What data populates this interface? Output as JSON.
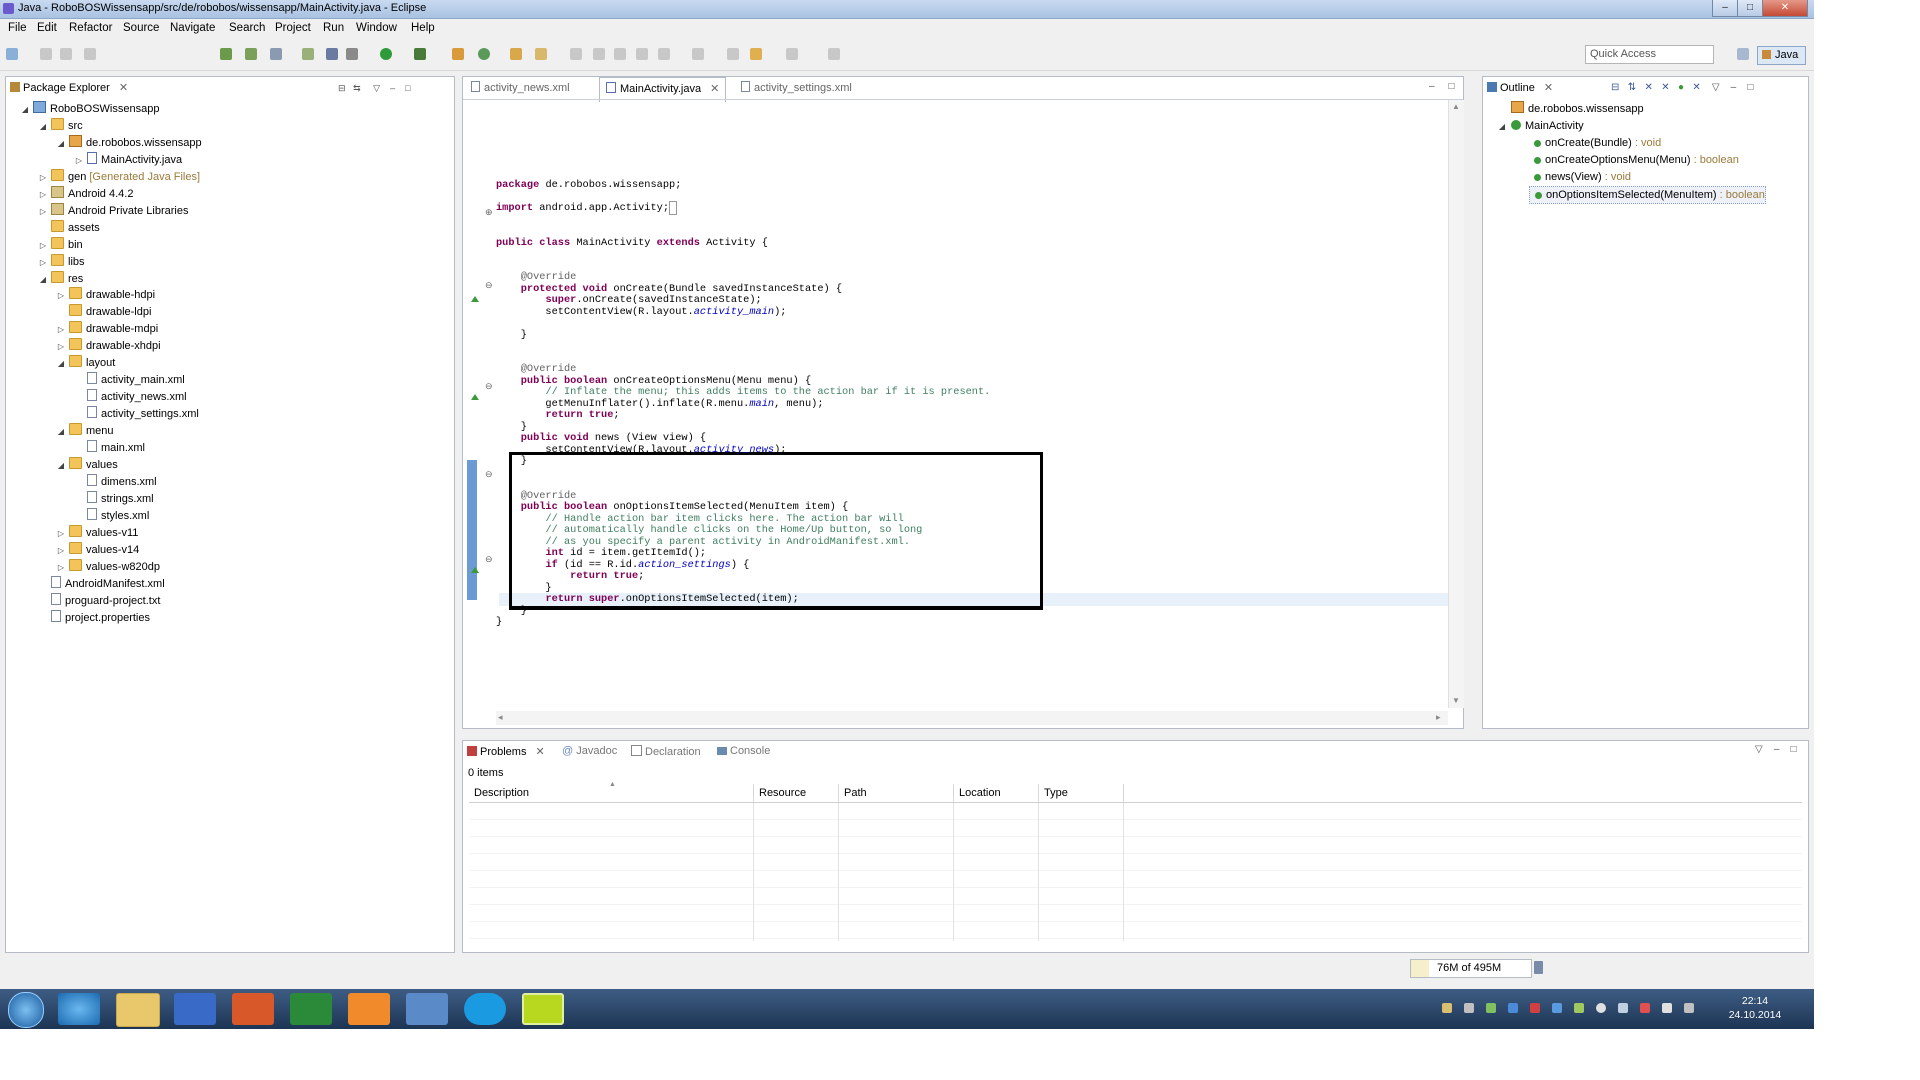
{
  "window": {
    "title": "Java - RoboBOSWissensapp/src/de/robobos/wissensapp/MainActivity.java - Eclipse",
    "controls": [
      "–",
      "□",
      "✕"
    ]
  },
  "menu": [
    "File",
    "Edit",
    "Refactor",
    "Source",
    "Navigate",
    "Search",
    "Project",
    "Run",
    "Window",
    "Help"
  ],
  "toolbar": {
    "quick_access_placeholder": "Quick Access",
    "perspective": "Java"
  },
  "package_explorer": {
    "title": "Package Explorer",
    "tree": [
      {
        "label": "RoboBOSWissensapp",
        "level": 0,
        "icon": "project-icon",
        "arrow": "▲"
      },
      {
        "label": "src",
        "level": 1,
        "icon": "folder-icon",
        "arrow": "▲"
      },
      {
        "label": "de.robobos.wissensapp",
        "level": 2,
        "icon": "package-icon",
        "arrow": "▲"
      },
      {
        "label": "MainActivity.java",
        "level": 3,
        "icon": "java-file-icon",
        "arrow": "▷"
      },
      {
        "label": "gen",
        "suffix": "[Generated Java Files]",
        "level": 1,
        "icon": "folder-icon",
        "arrow": "▷"
      },
      {
        "label": "Android 4.4.2",
        "level": 1,
        "icon": "library-icon",
        "arrow": "▷"
      },
      {
        "label": "Android Private Libraries",
        "level": 1,
        "icon": "library-icon",
        "arrow": "▷"
      },
      {
        "label": "assets",
        "level": 1,
        "icon": "folder-icon",
        "arrow": ""
      },
      {
        "label": "bin",
        "level": 1,
        "icon": "folder-icon",
        "arrow": "▷"
      },
      {
        "label": "libs",
        "level": 1,
        "icon": "folder-icon",
        "arrow": "▷"
      },
      {
        "label": "res",
        "level": 1,
        "icon": "folder-icon",
        "arrow": "▲"
      },
      {
        "label": "drawable-hdpi",
        "level": 2,
        "icon": "folder-icon",
        "arrow": "▷"
      },
      {
        "label": "drawable-ldpi",
        "level": 2,
        "icon": "folder-icon",
        "arrow": ""
      },
      {
        "label": "drawable-mdpi",
        "level": 2,
        "icon": "folder-icon",
        "arrow": "▷"
      },
      {
        "label": "drawable-xhdpi",
        "level": 2,
        "icon": "folder-icon",
        "arrow": "▷"
      },
      {
        "label": "layout",
        "level": 2,
        "icon": "folder-icon",
        "arrow": "▲"
      },
      {
        "label": "activity_main.xml",
        "level": 3,
        "icon": "xml-file-icon",
        "arrow": ""
      },
      {
        "label": "activity_news.xml",
        "level": 3,
        "icon": "xml-file-icon",
        "arrow": ""
      },
      {
        "label": "activity_settings.xml",
        "level": 3,
        "icon": "xml-file-icon",
        "arrow": ""
      },
      {
        "label": "menu",
        "level": 2,
        "icon": "folder-icon",
        "arrow": "▲"
      },
      {
        "label": "main.xml",
        "level": 3,
        "icon": "xml-file-icon",
        "arrow": ""
      },
      {
        "label": "values",
        "level": 2,
        "icon": "folder-icon",
        "arrow": "▲"
      },
      {
        "label": "dimens.xml",
        "level": 3,
        "icon": "xml-file-icon",
        "arrow": ""
      },
      {
        "label": "strings.xml",
        "level": 3,
        "icon": "xml-file-icon",
        "arrow": ""
      },
      {
        "label": "styles.xml",
        "level": 3,
        "icon": "xml-file-icon",
        "arrow": ""
      },
      {
        "label": "values-v11",
        "level": 2,
        "icon": "folder-icon",
        "arrow": "▷"
      },
      {
        "label": "values-v14",
        "level": 2,
        "icon": "folder-icon",
        "arrow": "▷"
      },
      {
        "label": "values-w820dp",
        "level": 2,
        "icon": "folder-icon",
        "arrow": "▷"
      },
      {
        "label": "AndroidManifest.xml",
        "level": 1,
        "icon": "xml-file-icon",
        "arrow": ""
      },
      {
        "label": "proguard-project.txt",
        "level": 1,
        "icon": "text-file-icon",
        "arrow": ""
      },
      {
        "label": "project.properties",
        "level": 1,
        "icon": "text-file-icon",
        "arrow": ""
      }
    ]
  },
  "editor": {
    "tabs": [
      {
        "label": "activity_news.xml",
        "active": false
      },
      {
        "label": "MainActivity.java",
        "active": true
      },
      {
        "label": "activity_settings.xml",
        "active": false
      }
    ]
  },
  "outline": {
    "title": "Outline",
    "items": [
      {
        "label": "de.robobos.wissensapp",
        "type": ""
      },
      {
        "label": "MainActivity",
        "type": ""
      },
      {
        "label": "onCreate(Bundle)",
        "type": " : void"
      },
      {
        "label": "onCreateOptionsMenu(Menu)",
        "type": " : boolean"
      },
      {
        "label": "news(View)",
        "type": " : void"
      },
      {
        "label": "onOptionsItemSelected(MenuItem)",
        "type": " : boolean"
      }
    ]
  },
  "bottom_panel": {
    "tabs": [
      "Problems",
      "Javadoc",
      "Declaration",
      "Console"
    ],
    "count": "0 items",
    "columns": [
      "Description",
      "Resource",
      "Path",
      "Location",
      "Type"
    ]
  },
  "status": {
    "memory": "76M of 495M"
  },
  "taskbar": {
    "apps": [
      "start-orb-icon",
      "ie-icon",
      "explorer-icon",
      "word-icon",
      "powerpoint-icon",
      "excel-icon",
      "media-player-icon",
      "network-icon",
      "skype-icon",
      "eclipse-icon"
    ],
    "time": "22:14",
    "date": "24.10.2014"
  },
  "colors": {
    "accent": "#3875d7",
    "highlight_box": "#000000",
    "taskbar": "#2a4670"
  }
}
